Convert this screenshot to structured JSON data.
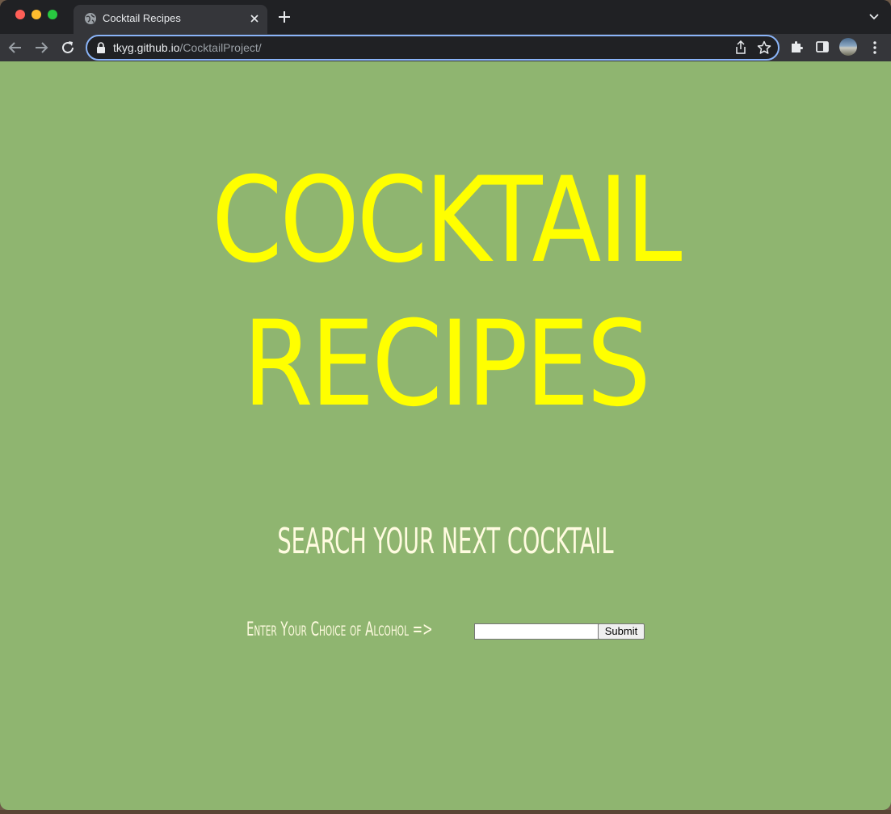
{
  "browser": {
    "tab_title": "Cocktail Recipes",
    "url_host": "tkyg.github.io",
    "url_path": "/CocktailProject/"
  },
  "page": {
    "hero_line1": "COCKTAIL",
    "hero_line2": "RECIPES",
    "subheading": "SEARCH YOUR NEXT COCKTAIL",
    "search_label": "Enter Your Choice of Alcohol =>",
    "search_value": "",
    "submit_label": "Submit"
  },
  "colors": {
    "page_background": "#8fb570",
    "hero_text": "#ffff00",
    "subtext": "#fffbe0"
  }
}
